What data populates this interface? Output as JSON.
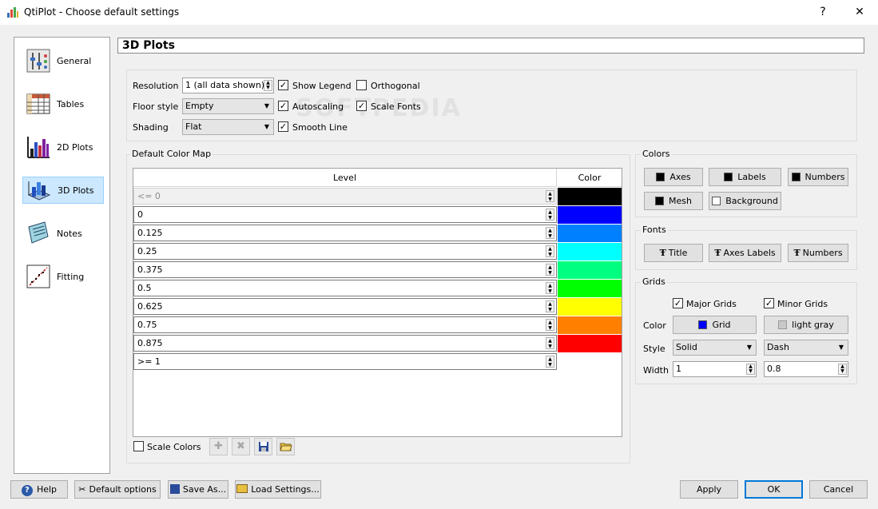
{
  "window": {
    "title": "QtiPlot - Choose default settings",
    "help_glyph": "?",
    "close_glyph": "✕"
  },
  "sidebar": {
    "items": [
      {
        "label": "General",
        "icon": "general-icon"
      },
      {
        "label": "Tables",
        "icon": "tables-icon"
      },
      {
        "label": "2D Plots",
        "icon": "2d-plots-icon"
      },
      {
        "label": "3D Plots",
        "icon": "3d-plots-icon",
        "selected": true
      },
      {
        "label": "Notes",
        "icon": "notes-icon"
      },
      {
        "label": "Fitting",
        "icon": "fitting-icon"
      }
    ]
  },
  "page": {
    "title": "3D Plots",
    "watermark": "SOFTPEDIA"
  },
  "general_box": {
    "resolution_label": "Resolution",
    "resolution_value": "1 (all data shown)",
    "floor_style_label": "Floor style",
    "floor_style_value": "Empty",
    "shading_label": "Shading",
    "shading_value": "Flat",
    "show_legend_label": "Show Legend",
    "show_legend_checked": true,
    "orthogonal_label": "Orthogonal",
    "orthogonal_checked": false,
    "autoscaling_label": "Autoscaling",
    "autoscaling_checked": true,
    "scale_fonts_label": "Scale Fonts",
    "scale_fonts_checked": true,
    "smooth_line_label": "Smooth Line",
    "smooth_line_checked": true
  },
  "color_map": {
    "title": "Default Color Map",
    "level_header": "Level",
    "color_header": "Color",
    "rows": [
      {
        "level": "<= 0",
        "color": "#000000",
        "disabled": true
      },
      {
        "level": "0",
        "color": "#0000ff"
      },
      {
        "level": "0.125",
        "color": "#0080ff"
      },
      {
        "level": "0.25",
        "color": "#00ffff"
      },
      {
        "level": "0.375",
        "color": "#00ff80"
      },
      {
        "level": "0.5",
        "color": "#00ff00"
      },
      {
        "level": "0.625",
        "color": "#ffff00"
      },
      {
        "level": "0.75",
        "color": "#ff8000"
      },
      {
        "level": "0.875",
        "color": "#ff0000"
      },
      {
        "level": ">= 1",
        "color": "#ffffff"
      }
    ],
    "scale_colors_label": "Scale Colors",
    "scale_colors_checked": false
  },
  "colors_box": {
    "title": "Colors",
    "axes_label": "Axes",
    "labels_label": "Labels",
    "numbers_label": "Numbers",
    "mesh_label": "Mesh",
    "background_label": "Background",
    "swatch_dark": "#000000",
    "swatch_light": "#ffffff"
  },
  "fonts_box": {
    "title": "Fonts",
    "title_label": "Title",
    "axes_labels_label": "Axes Labels",
    "numbers_label": "Numbers"
  },
  "grids_box": {
    "title": "Grids",
    "major_label": "Major Grids",
    "major_checked": true,
    "minor_label": "Minor Grids",
    "minor_checked": true,
    "color_label": "Color",
    "major_color_label": "Grid",
    "major_color": "#0000ff",
    "minor_color_label": "light gray",
    "minor_color": "#c8c8c8",
    "style_label": "Style",
    "major_style": "Solid",
    "minor_style": "Dash",
    "width_label": "Width",
    "major_width": "1",
    "minor_width": "0.8"
  },
  "footer": {
    "help_label": "Help",
    "default_options_label": "Default options",
    "save_as_label": "Save As...",
    "load_settings_label": "Load Settings...",
    "apply_label": "Apply",
    "ok_label": "OK",
    "cancel_label": "Cancel"
  },
  "check_glyph": "✓"
}
